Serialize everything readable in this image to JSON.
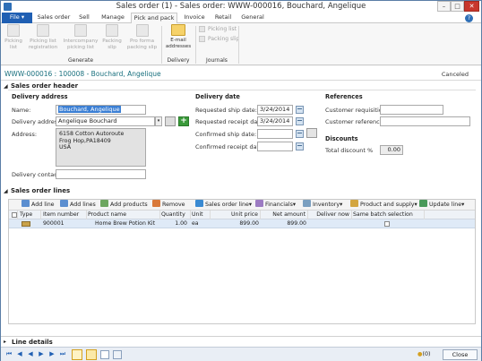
{
  "window": {
    "title": "Sales order (1) - Sales order: WWW-000016, Bouchard, Angelique",
    "min": "–",
    "max": "□",
    "close": "✕"
  },
  "ribbon": {
    "tabs": [
      "File",
      "Sales order",
      "Sell",
      "Manage",
      "Pick and pack",
      "Invoice",
      "Retail",
      "General"
    ],
    "file_arrow": "▾",
    "buttons": {
      "picking_list": "Picking list",
      "picking_list_reg": "Picking list registration",
      "intercompany": "Intercompany picking list",
      "packing_slip": "Packing slip",
      "pro_forma": "Pro forma packing slip",
      "email": "E-mail addresses",
      "journal_picking": "Picking list",
      "journal_packing": "Packing slip"
    },
    "groups": {
      "generate": "Generate",
      "delivery": "Delivery",
      "journals": "Journals"
    }
  },
  "header": {
    "title": "WWW-000016 : 100008 - Bouchard, Angelique",
    "status": "Canceled",
    "section": "Sales order header"
  },
  "delivery_address": {
    "title": "Delivery address",
    "name_label": "Name:",
    "name_value": "Bouchard, Angelique",
    "addr_label": "Delivery address:",
    "addr_value": "Angelique Bouchard",
    "address_label": "Address:",
    "address_lines": [
      "6158 Cotton Autoroute",
      "Frog Hop,PA18409",
      "USA"
    ],
    "contact_label": "Delivery contact:",
    "contact_value": ""
  },
  "delivery_date": {
    "title": "Delivery date",
    "req_ship_label": "Requested ship date:",
    "req_ship_value": "3/24/2014",
    "req_receipt_label": "Requested receipt date:",
    "req_receipt_value": "3/24/2014",
    "conf_ship_label": "Confirmed ship date:",
    "conf_ship_value": "",
    "conf_receipt_label": "Confirmed receipt date:",
    "conf_receipt_value": ""
  },
  "references": {
    "title": "References",
    "req_label": "Customer requisition:",
    "req_value": "",
    "ref_label": "Customer reference:",
    "ref_value": ""
  },
  "discounts": {
    "title": "Discounts",
    "total_label": "Total discount %",
    "total_value": "0.00"
  },
  "lines": {
    "section": "Sales order lines",
    "toolbar": [
      "Add line",
      "Add lines",
      "Add products",
      "Remove",
      "Sales order line",
      "Financials",
      "Inventory",
      "Product and supply",
      "Update line"
    ],
    "columns": [
      "Type",
      "Item number",
      "Product name",
      "Quantity",
      "Unit",
      "Unit price",
      "Net amount",
      "Deliver now",
      "Same batch selection"
    ],
    "rows": [
      {
        "item": "900001",
        "product": "Home Brew Potion Kit",
        "qty": "1.00",
        "unit": "ea",
        "price": "899.00",
        "net": "899.00",
        "deliver": ""
      }
    ]
  },
  "line_details": "Line details",
  "status": {
    "count": "(0)",
    "close": "Close"
  },
  "colors": {
    "accent": "#1f5fb3",
    "header_text": "#19707e",
    "selection": "#3b7fd4"
  }
}
